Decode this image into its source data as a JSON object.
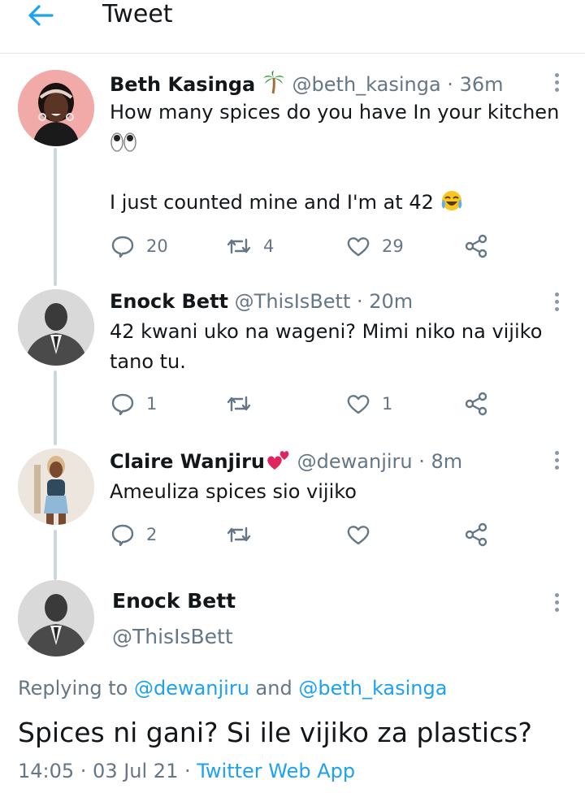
{
  "header": {
    "title": "Tweet"
  },
  "tweets": [
    {
      "name": "Beth Kasinga",
      "name_emoji": "palm-tree",
      "handle": "@beth_kasinga",
      "separator": " · ",
      "time": "36m",
      "lines": [
        "How many spices do you have In your kitchen",
        "",
        "",
        "I just counted mine and I'm at 42"
      ],
      "replies": "20",
      "retweets": "4",
      "likes": "29"
    },
    {
      "name": "Enock Bett",
      "handle": "@ThisIsBett",
      "separator": " · ",
      "time": "20m",
      "lines": [
        "42 kwani uko na wageni? Mimi niko na vijiko",
        "tano tu."
      ],
      "replies": "1",
      "retweets": "",
      "likes": "1"
    },
    {
      "name": "Claire Wanjiru",
      "name_emoji": "two-hearts",
      "handle": "@dewanjiru",
      "separator": " · ",
      "time": "8m",
      "lines": [
        "Ameuliza spices sio vijiko"
      ],
      "replies": "2",
      "retweets": "",
      "likes": ""
    }
  ],
  "main": {
    "name": "Enock Bett",
    "handle": "@ThisIsBett",
    "replying_prefix": "Replying to ",
    "replying_user1": "@dewanjiru",
    "replying_and": " and ",
    "replying_user2": "@beth_kasinga",
    "text": "Spices ni gani? Si ile vijiko za plastics?",
    "time": "14:05 · 03 Jul 21 · ",
    "source": "Twitter Web App"
  },
  "colors": {
    "accent": "#1da1f2",
    "secondary_text": "#657786",
    "thread_line": "#ccd6dd"
  }
}
